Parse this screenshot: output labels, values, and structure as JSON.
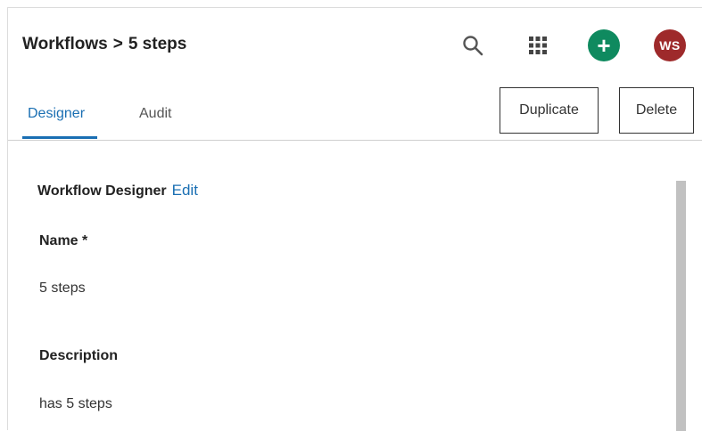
{
  "header": {
    "breadcrumb_root": "Workflows",
    "breadcrumb_separator": ">",
    "breadcrumb_current": "5 steps",
    "search_icon": "search-icon",
    "apps_icon": "apps-grid-icon",
    "add_label": "+",
    "avatar_initials": "WS"
  },
  "tabs": [
    {
      "label": "Designer",
      "active": true
    },
    {
      "label": "Audit",
      "active": false
    }
  ],
  "actions": {
    "duplicate_label": "Duplicate",
    "delete_label": "Delete"
  },
  "designer": {
    "title": "Workflow Designer",
    "edit_label": "Edit",
    "name_label": "Name *",
    "name_value": "5 steps",
    "description_label": "Description",
    "description_value": "has 5 steps"
  },
  "colors": {
    "accent": "#1a6fb3",
    "add_button": "#0f8a5f",
    "avatar": "#9e2a2b"
  }
}
